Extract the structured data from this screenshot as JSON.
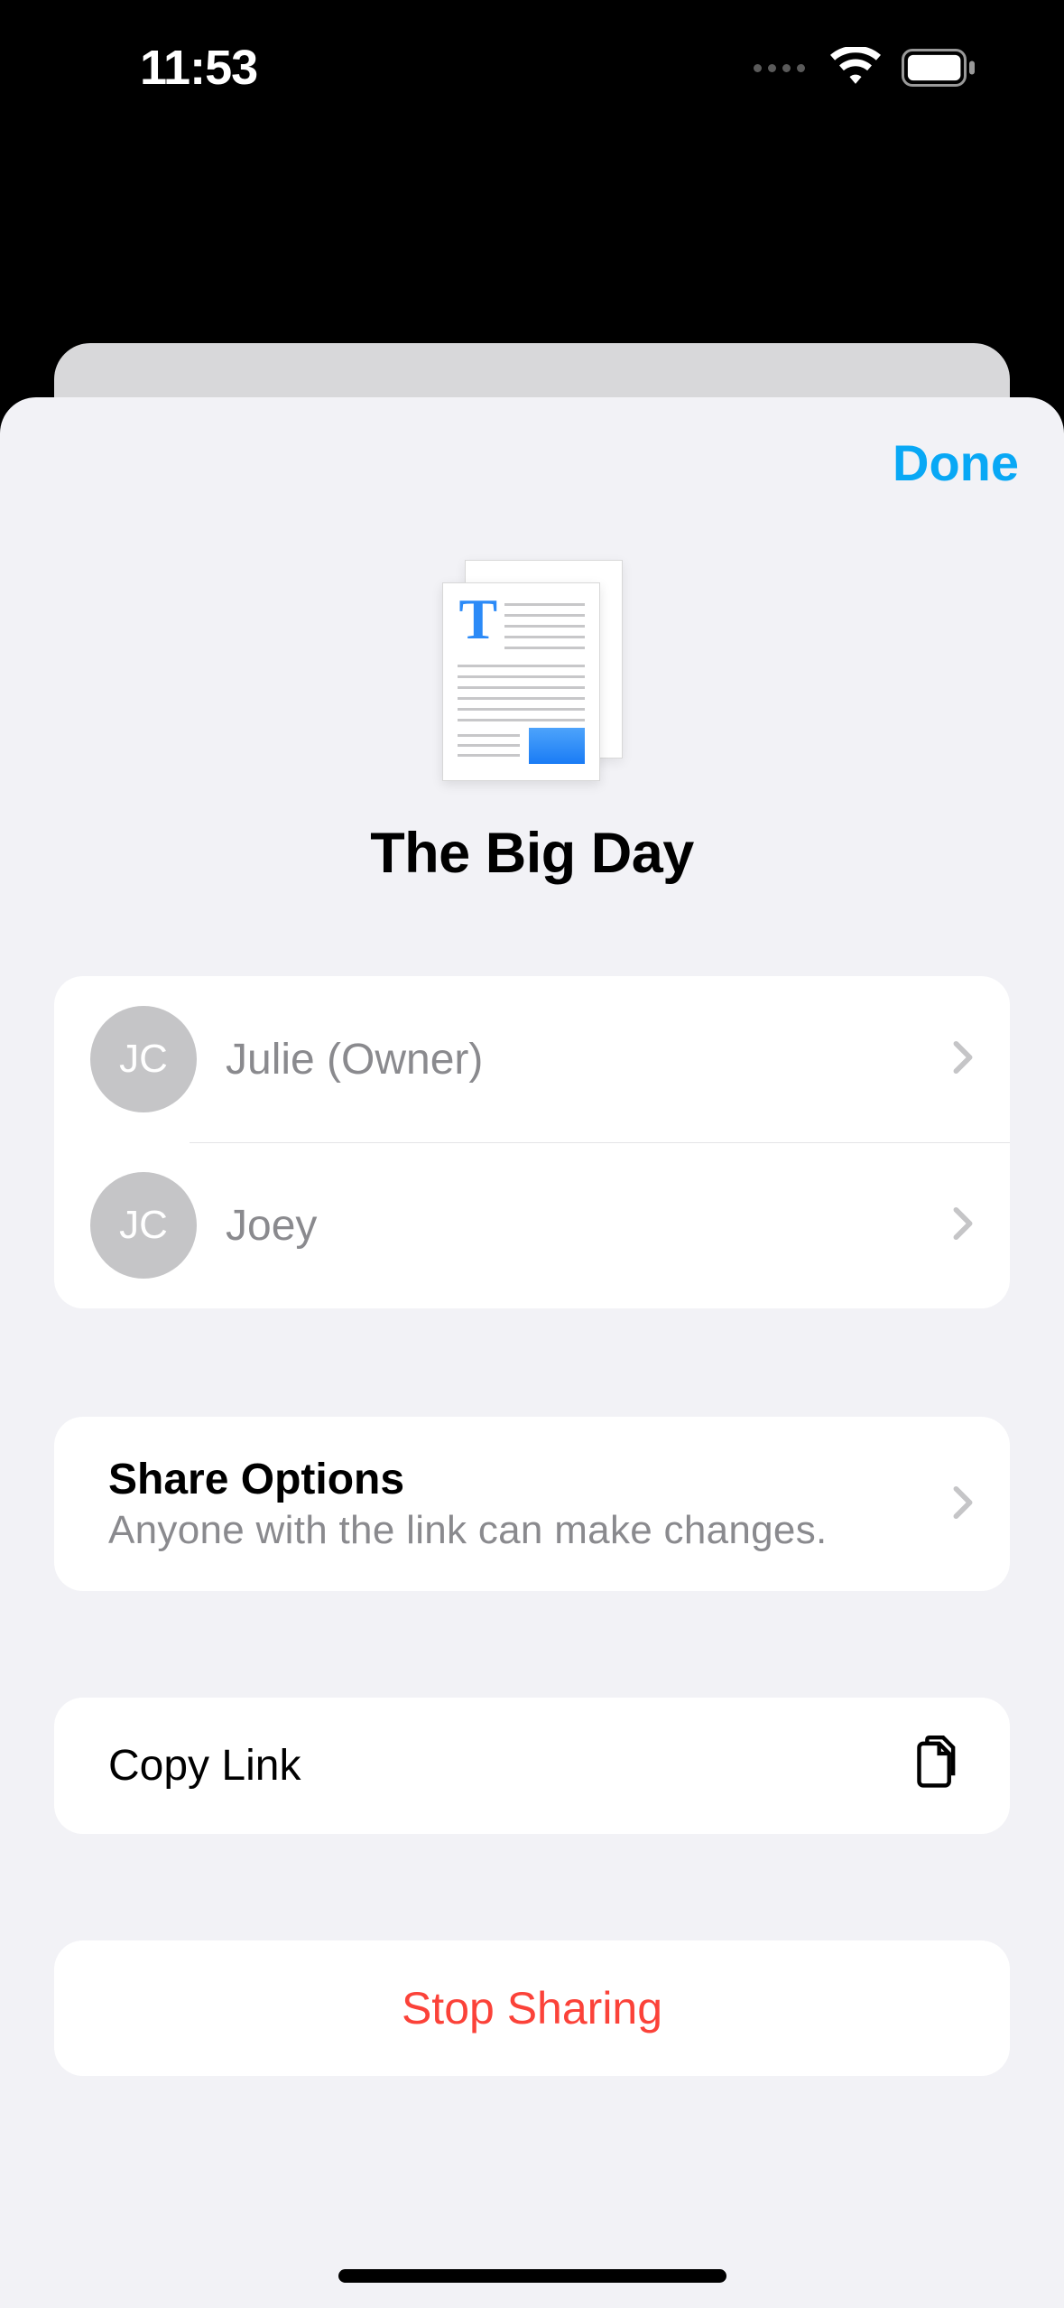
{
  "status": {
    "time": "11:53"
  },
  "header": {
    "done_label": "Done"
  },
  "document": {
    "title": "The Big Day"
  },
  "people": [
    {
      "initials": "JC",
      "name": "Julie (Owner)"
    },
    {
      "initials": "JC",
      "name": "Joey"
    }
  ],
  "share_options": {
    "title": "Share Options",
    "subtitle": "Anyone with the link can make changes."
  },
  "copy_link": {
    "label": "Copy Link"
  },
  "stop_sharing": {
    "label": "Stop Sharing"
  }
}
